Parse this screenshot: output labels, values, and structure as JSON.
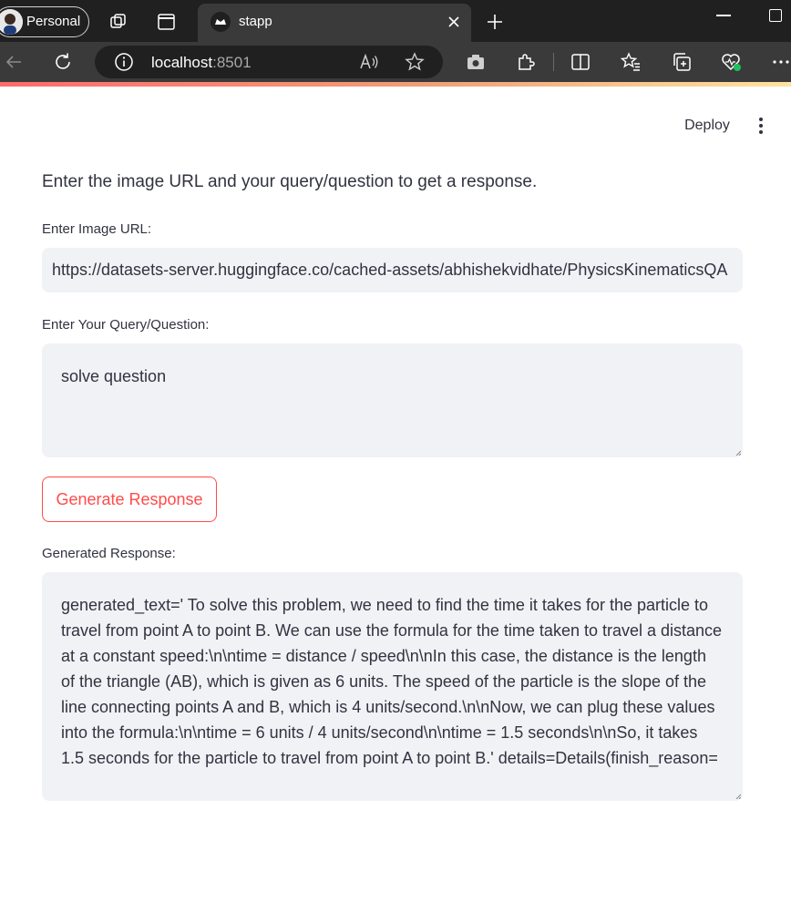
{
  "browser": {
    "profile_label": "Personal",
    "active_tab_title": "stapp",
    "url_host": "localhost",
    "url_port": ":8501",
    "icons": [
      "avatar",
      "workspaces-icon",
      "tab-actions-icon",
      "streamlit-favicon",
      "close-icon",
      "new-tab-icon",
      "minimize-icon",
      "maximize-icon",
      "back-icon",
      "refresh-icon",
      "site-info-icon",
      "read-aloud-icon",
      "favorite-star-icon",
      "screenshot-icon",
      "extensions-icon",
      "split-screen-icon",
      "favorites-icon",
      "collections-icon",
      "browser-essentials-icon",
      "more-icon"
    ]
  },
  "app": {
    "deploy_label": "Deploy",
    "intro_text": "Enter the image URL and your query/question to get a response.",
    "image_url_label": "Enter Image URL:",
    "image_url_value": "https://datasets-server.huggingface.co/cached-assets/abhishekvidhate/PhysicsKinematicsQA",
    "query_label": "Enter Your Query/Question:",
    "query_value": "solve question",
    "generate_button_label": "Generate Response",
    "response_label": "Generated Response:",
    "response_value": "generated_text=' To solve this problem, we need to find the time it takes for the particle to travel from point A to point B. We can use the formula for the time taken to travel a distance at a constant speed:\\n\\ntime = distance / speed\\n\\nIn this case, the distance is the length of the triangle (AB), which is given as 6 units. The speed of the particle is the slope of the line connecting points A and B, which is 4 units/second.\\n\\nNow, we can plug these values into the formula:\\n\\ntime = 6 units / 4 units/second\\n\\ntime = 1.5 seconds\\n\\nSo, it takes 1.5 seconds for the particle to travel from point A to point B.' details=Details(finish_reason="
  },
  "colors": {
    "primary": "#ff4b4b",
    "text": "#31333f",
    "input_background": "#f0f2f6",
    "browser_frame": "#202020",
    "browser_toolbar": "#3a3a3a"
  }
}
